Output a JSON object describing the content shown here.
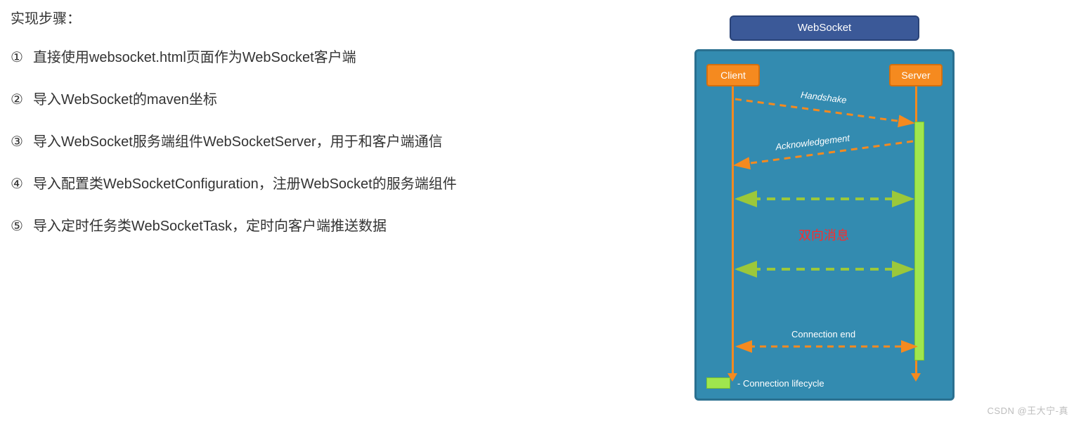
{
  "heading": "实现步骤：",
  "steps": [
    {
      "num": "①",
      "text": "直接使用websocket.html页面作为WebSocket客户端"
    },
    {
      "num": "②",
      "text": "导入WebSocket的maven坐标"
    },
    {
      "num": "③",
      "text": "导入WebSocket服务端组件WebSocketServer，用于和客户端通信"
    },
    {
      "num": "④",
      "text": "导入配置类WebSocketConfiguration，注册WebSocket的服务端组件"
    },
    {
      "num": "⑤",
      "text": "导入定时任务类WebSocketTask，定时向客户端推送数据"
    }
  ],
  "diagram": {
    "title": "WebSocket",
    "client": "Client",
    "server": "Server",
    "handshake": "Handshake",
    "ack": "Acknowledgement",
    "bidi": "双向消息",
    "conn_end": "Connection end",
    "legend": "- Connection lifecycle"
  },
  "watermark": "CSDN @王大宁-真",
  "colors": {
    "title_bg": "#3b5998",
    "body_bg": "#338bb0",
    "node_bg": "#f58a1f",
    "lifecycle": "#9fe64e",
    "bidi_arrow": "#9cc83a",
    "msg_text": "#ff2a2a"
  }
}
